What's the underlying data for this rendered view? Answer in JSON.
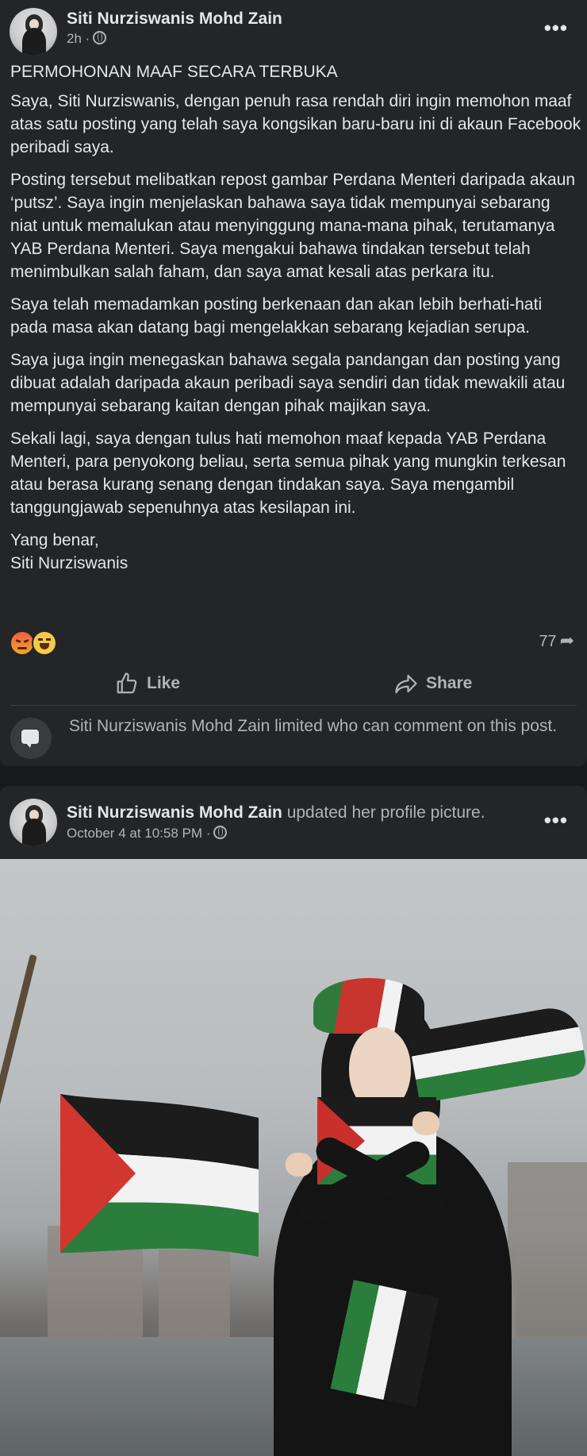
{
  "post1": {
    "author": "Siti Nurziswanis Mohd Zain",
    "time": "2h",
    "privacy_separator": "·",
    "privacy_icon": "globe-icon",
    "more_label": "•••",
    "paragraphs": [
      "PERMOHONAN MAAF SECARA TERBUKA",
      "Saya, Siti Nurziswanis, dengan penuh rasa rendah diri ingin memohon maaf atas satu posting yang telah saya kongsikan baru-baru ini di akaun Facebook peribadi saya.",
      "Posting tersebut melibatkan repost gambar Perdana Menteri daripada akaun  ‘putsz’. Saya ingin menjelaskan bahawa saya tidak mempunyai sebarang niat untuk memalukan atau menyinggung mana-mana pihak, terutamanya YAB Perdana Menteri. Saya mengakui bahawa tindakan tersebut telah menimbulkan salah faham, dan saya amat kesali atas perkara itu.",
      "Saya telah memadamkan posting berkenaan dan akan lebih berhati-hati pada masa akan datang bagi mengelakkan sebarang kejadian serupa.",
      "Saya juga ingin menegaskan bahawa segala pandangan dan posting yang dibuat adalah daripada akaun peribadi saya sendiri dan tidak mewakili atau mempunyai sebarang kaitan dengan pihak majikan saya.",
      "Sekali lagi, saya dengan tulus hati memohon maaf kepada YAB Perdana Menteri, para penyokong beliau, serta semua pihak yang mungkin terkesan atau berasa kurang senang dengan tindakan saya. Saya mengambil tanggungjawab sepenuhnya atas kesilapan ini.",
      "Yang benar,\nSiti Nurziswanis"
    ],
    "reactions": [
      "angry-emoji",
      "haha-emoji"
    ],
    "share_count": "77",
    "like_label": "Like",
    "share_label": "Share",
    "comment_notice": "Siti Nurziswanis Mohd Zain limited who can comment on this post."
  },
  "post2": {
    "author": "Siti Nurziswanis Mohd Zain",
    "action_text": "updated her profile picture.",
    "time": "October 4 at 10:58 PM",
    "privacy_separator": "·",
    "more_label": "•••"
  },
  "colors": {
    "background": "#18191a",
    "card": "#242526",
    "text_primary": "#e4e6eb",
    "text_secondary": "#b0b3b8"
  }
}
